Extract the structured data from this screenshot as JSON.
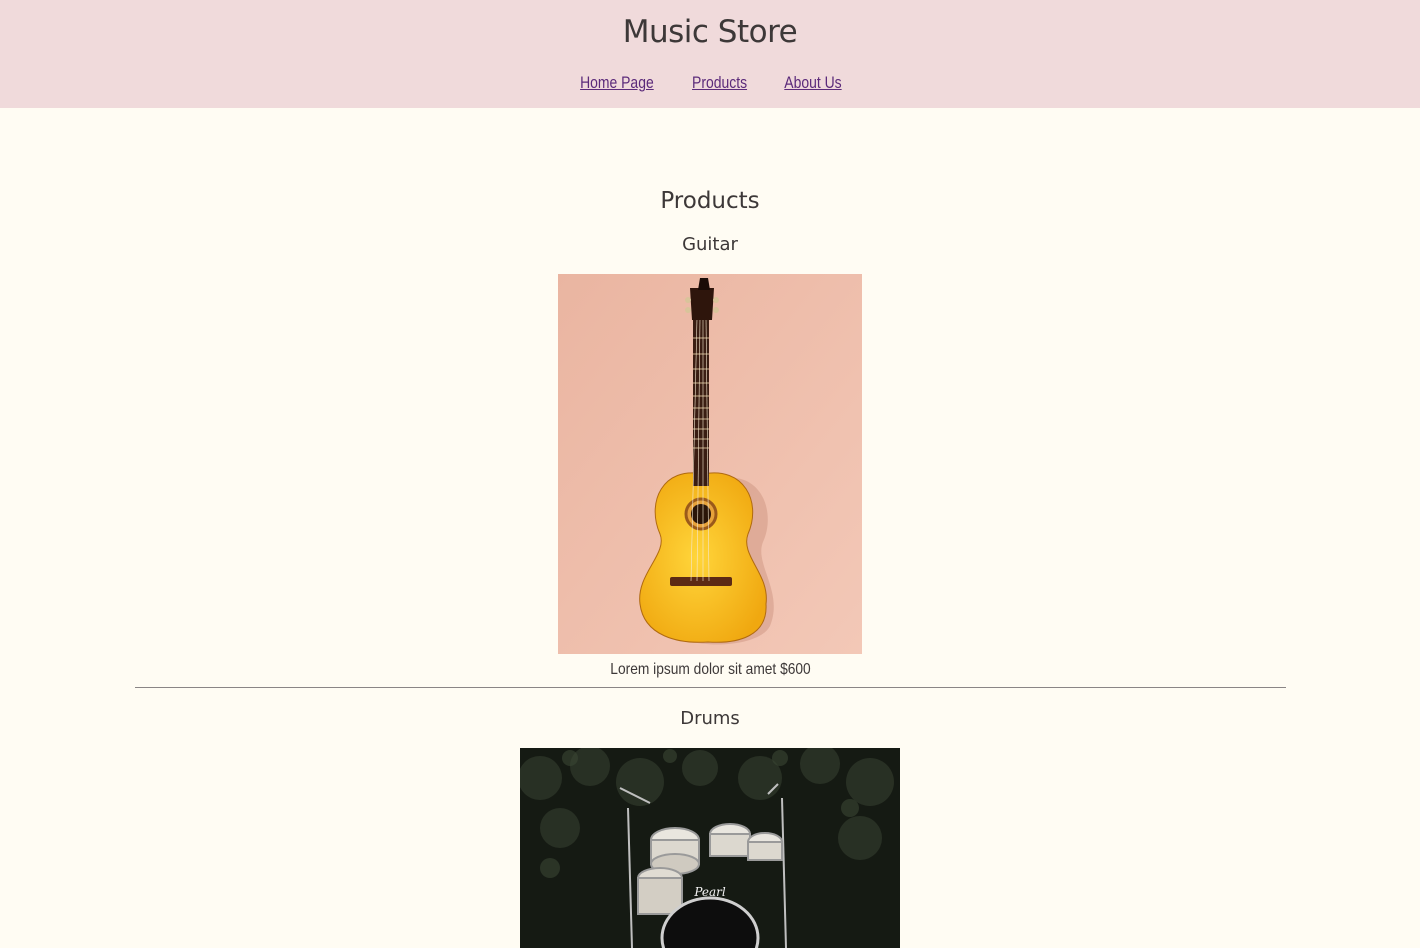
{
  "site": {
    "title": "Music Store"
  },
  "nav": {
    "items": [
      {
        "label": "Home Page"
      },
      {
        "label": "Products"
      },
      {
        "label": "About Us"
      }
    ]
  },
  "main": {
    "heading": "Products",
    "products": [
      {
        "name": "Guitar",
        "caption": "Lorem ipsum dolor sit amet $600",
        "image_icon": "guitar-photo"
      },
      {
        "name": "Drums",
        "image_icon": "drum-kit-photo"
      }
    ]
  },
  "colors": {
    "header_bg": "#f0dadb",
    "page_bg": "#fffcf3",
    "link": "#5b2a7a",
    "text": "#3d3838"
  }
}
